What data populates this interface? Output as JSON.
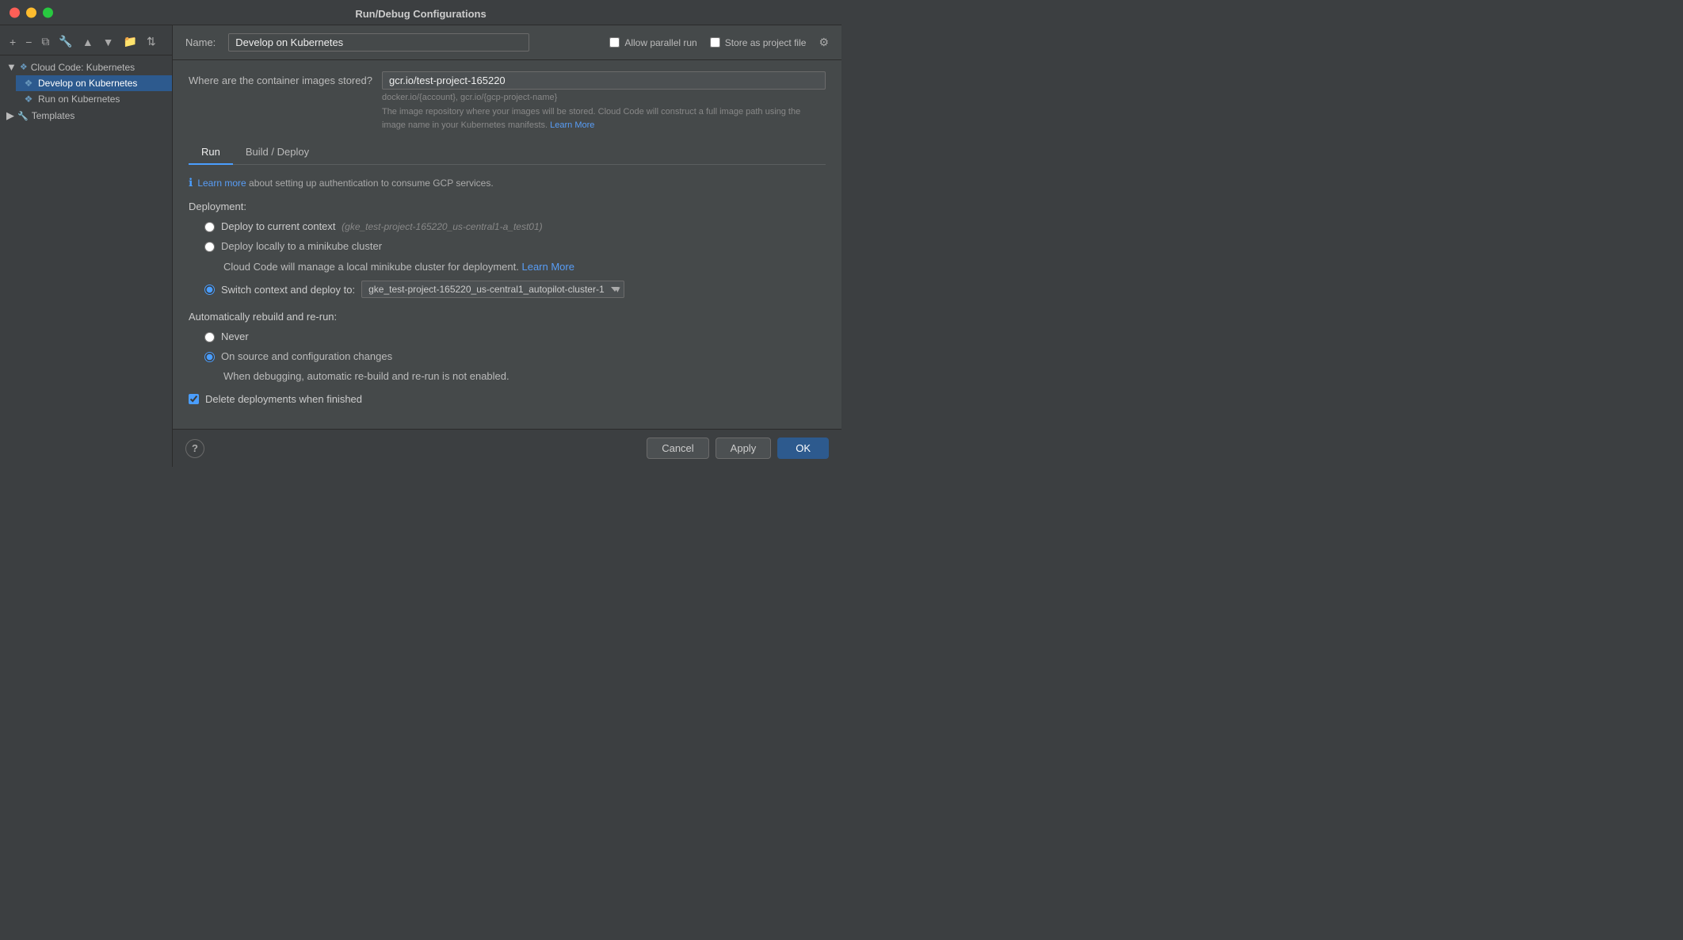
{
  "window": {
    "title": "Run/Debug Configurations"
  },
  "sidebar": {
    "toolbar_buttons": [
      "+",
      "−",
      "⧉",
      "🔧",
      "▲",
      "▼",
      "📁",
      "⇅"
    ],
    "groups": [
      {
        "id": "cloud-code-kubernetes",
        "label": "Cloud Code: Kubernetes",
        "expanded": true,
        "icon": "❖",
        "children": [
          {
            "id": "develop-on-kubernetes",
            "label": "Develop on Kubernetes",
            "icon": "❖",
            "selected": true
          },
          {
            "id": "run-on-kubernetes",
            "label": "Run on Kubernetes",
            "icon": "❖",
            "selected": false
          }
        ]
      },
      {
        "id": "templates",
        "label": "Templates",
        "expanded": false,
        "icon": "🔧",
        "children": []
      }
    ]
  },
  "header": {
    "name_label": "Name:",
    "name_value": "Develop on Kubernetes",
    "allow_parallel_run_label": "Allow parallel run",
    "allow_parallel_run_checked": false,
    "store_as_project_file_label": "Store as project file",
    "store_as_project_file_checked": false
  },
  "content": {
    "image_row": {
      "label": "Where are the container images stored?",
      "value": "gcr.io/test-project-165220",
      "hint": "docker.io/{account}, gcr.io/{gcp-project-name}",
      "description": "The image repository where your images will be stored. Cloud Code will construct a full image path using the image name in your Kubernetes manifests.",
      "learn_more_text": "Learn More",
      "learn_more_url": "#"
    },
    "tabs": [
      {
        "id": "run",
        "label": "Run",
        "active": true
      },
      {
        "id": "build-deploy",
        "label": "Build / Deploy",
        "active": false
      }
    ],
    "info_banner": {
      "text_before": "",
      "link_text": "Learn more",
      "text_after": " about setting up authentication to consume GCP services."
    },
    "deployment_section": {
      "label": "Deployment:",
      "options": [
        {
          "id": "deploy-current-context",
          "label": "Deploy to current context",
          "hint": "(gke_test-project-165220_us-central1-a_test01)",
          "checked": false,
          "sub_text": null
        },
        {
          "id": "deploy-minikube",
          "label": "Deploy locally to a minikube cluster",
          "checked": false,
          "sub_text": "Cloud Code will manage a local minikube cluster for deployment.",
          "learn_more_text": "Learn More",
          "learn_more_url": "#"
        },
        {
          "id": "switch-context",
          "label": "Switch context and deploy to:",
          "checked": true,
          "dropdown_value": "gke_test-project-165220_us-central1_autopilot-cluster-1",
          "dropdown_options": [
            "gke_test-project-165220_us-central1_autopilot-cluster-1"
          ]
        }
      ]
    },
    "auto_rebuild_section": {
      "label": "Automatically rebuild and re-run:",
      "options": [
        {
          "id": "never",
          "label": "Never",
          "checked": false
        },
        {
          "id": "on-source-changes",
          "label": "On source and configuration changes",
          "checked": true,
          "sub_text": "When debugging, automatic re-build and re-run is not enabled."
        }
      ]
    },
    "delete_deployments": {
      "label": "Delete deployments when finished",
      "checked": true
    }
  },
  "footer": {
    "help_label": "?",
    "cancel_label": "Cancel",
    "apply_label": "Apply",
    "ok_label": "OK"
  }
}
